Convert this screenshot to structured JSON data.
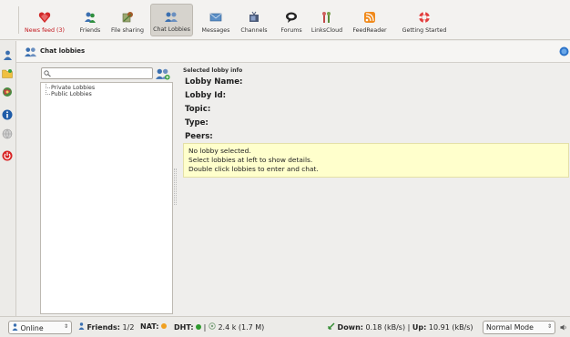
{
  "toolbar": {
    "items": [
      {
        "label": "News feed (3)",
        "icon": "heart-icon",
        "active": false
      },
      {
        "label": "Friends",
        "icon": "friends-icon",
        "active": false
      },
      {
        "label": "File sharing",
        "icon": "file-sharing-icon",
        "active": false
      },
      {
        "label": "Chat Lobbies",
        "icon": "chat-lobbies-icon",
        "active": true
      },
      {
        "label": "Messages",
        "icon": "messages-icon",
        "active": false
      },
      {
        "label": "Channels",
        "icon": "channels-icon",
        "active": false
      },
      {
        "label": "Forums",
        "icon": "forums-icon",
        "active": false
      },
      {
        "label": "LinksCloud",
        "icon": "links-cloud-icon",
        "active": false
      },
      {
        "label": "FeedReader",
        "icon": "feed-reader-icon",
        "active": false
      },
      {
        "label": "Getting Started",
        "icon": "getting-started-icon",
        "active": false
      }
    ]
  },
  "panel": {
    "title": "Chat lobbies",
    "search_value": "",
    "tree": [
      "Private Lobbies",
      "Public Lobbies"
    ],
    "info_heading": "Selected lobby info",
    "fields": [
      "Lobby Name:",
      "Lobby Id:",
      "Topic:",
      "Type:",
      "Peers:"
    ],
    "notice": [
      "No lobby selected.",
      "Select lobbies at left to show details.",
      "Double click lobbies to enter and chat."
    ]
  },
  "status": {
    "online": "Online",
    "friends_label": "Friends:",
    "friends_value": "1/2",
    "nat_label": "NAT:",
    "dht_label": "DHT:",
    "dht_value": "2.4 k (1.7 M)",
    "down_label": "Down:",
    "down_value": "0.18 (kB/s)",
    "up_label": "Up:",
    "up_value": "10.91 (kB/s)",
    "mode": "Normal Mode",
    "separator": "|"
  },
  "colors": {
    "accent_red": "#c3161c",
    "nat_status": "#f0a020",
    "dht_status": "#2e9a2e",
    "notice_bg": "#ffffcc"
  }
}
